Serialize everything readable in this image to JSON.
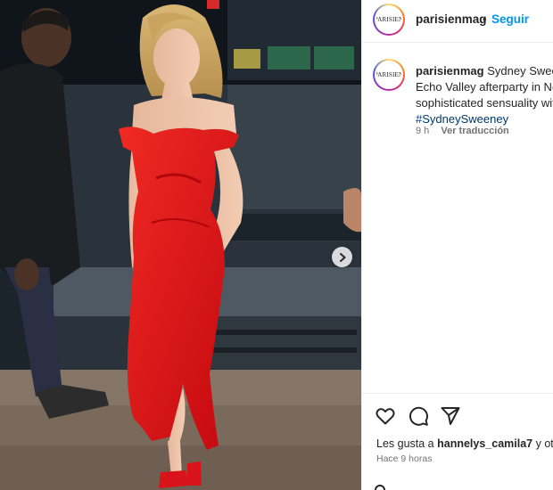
{
  "header": {
    "avatar_text": "PARISIEN",
    "username": "parisienmag",
    "separator": "•",
    "follow_label": "Seguir"
  },
  "caption": {
    "username": "parisienmag",
    "line1": "Sydney Sweene",
    "line2": "Echo Valley afterparty in New",
    "line3": "sophisticated sensuality with",
    "hashtag": "#SydneySweeney",
    "age": "9 h",
    "translate_label": "Ver traducción"
  },
  "actions": {
    "like_icon": "heart-icon",
    "comment_icon": "comment-icon",
    "share_icon": "share-icon"
  },
  "likes": {
    "prefix": "Les gusta a",
    "user": "hannelys_camila7",
    "suffix": "y otra"
  },
  "timestamp": "Hace 9 horas",
  "photo": {
    "next_icon": "chevron-right-icon",
    "dress_color": "#e0161b",
    "background_color": "#1b232b"
  }
}
